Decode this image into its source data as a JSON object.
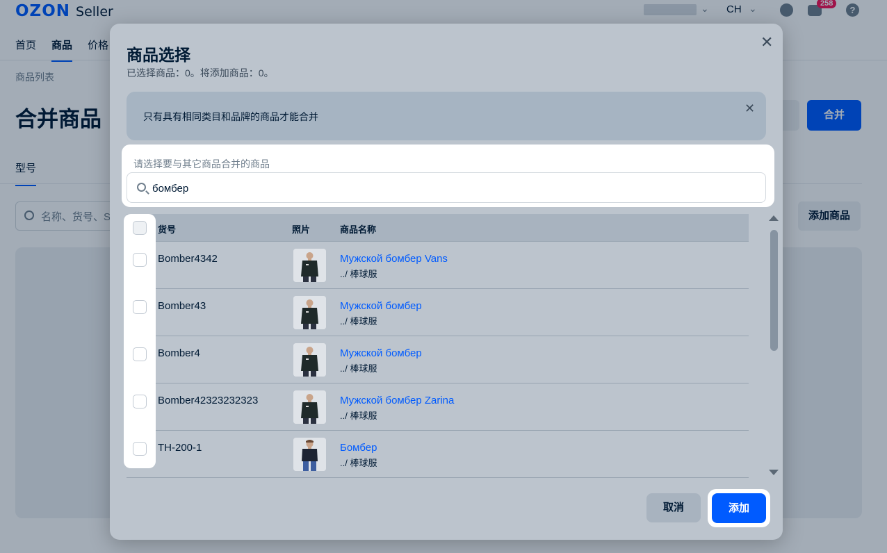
{
  "header": {
    "brand": "OZON",
    "brand_suffix": "Seller",
    "lang": "CH",
    "chat_badge": "258",
    "help_glyph": "?"
  },
  "nav": [
    "首页",
    "商品",
    "价格"
  ],
  "breadcrumb": "商品列表",
  "page_title": "合并商品",
  "merge_button": "合并",
  "tab_model": "型号",
  "bg_search_placeholder": "名称、货号、S",
  "add_product_button": "添加商品",
  "modal": {
    "title": "商品选择",
    "subtitle": "已选择商品：0。将添加商品：0。",
    "close_glyph": "✕",
    "notice": "只有具有相同类目和品牌的商品才能合并",
    "notice_close_glyph": "✕",
    "search_label": "请选择要与其它商品合并的商品",
    "search_value": "бомбер",
    "columns": [
      "货号",
      "照片",
      "商品名称"
    ],
    "rows": [
      {
        "sku": "Bomber4342",
        "name": "Мужской бомбер Vans",
        "category": "../ 棒球服"
      },
      {
        "sku": "Bomber43",
        "name": "Мужской бомбер",
        "category": "../ 棒球服"
      },
      {
        "sku": "Bomber4",
        "name": "Мужской бомбер",
        "category": "../ 棒球服"
      },
      {
        "sku": "Bomber42323232323",
        "name": "Мужской бомбер Zarina",
        "category": "../ 棒球服"
      },
      {
        "sku": "TH-200-1",
        "name": "Бомбер",
        "category": "../ 棒球服"
      }
    ],
    "cancel_button": "取消",
    "add_button": "添加"
  },
  "colors": {
    "accent": "#005bff",
    "badge": "#f91155"
  }
}
